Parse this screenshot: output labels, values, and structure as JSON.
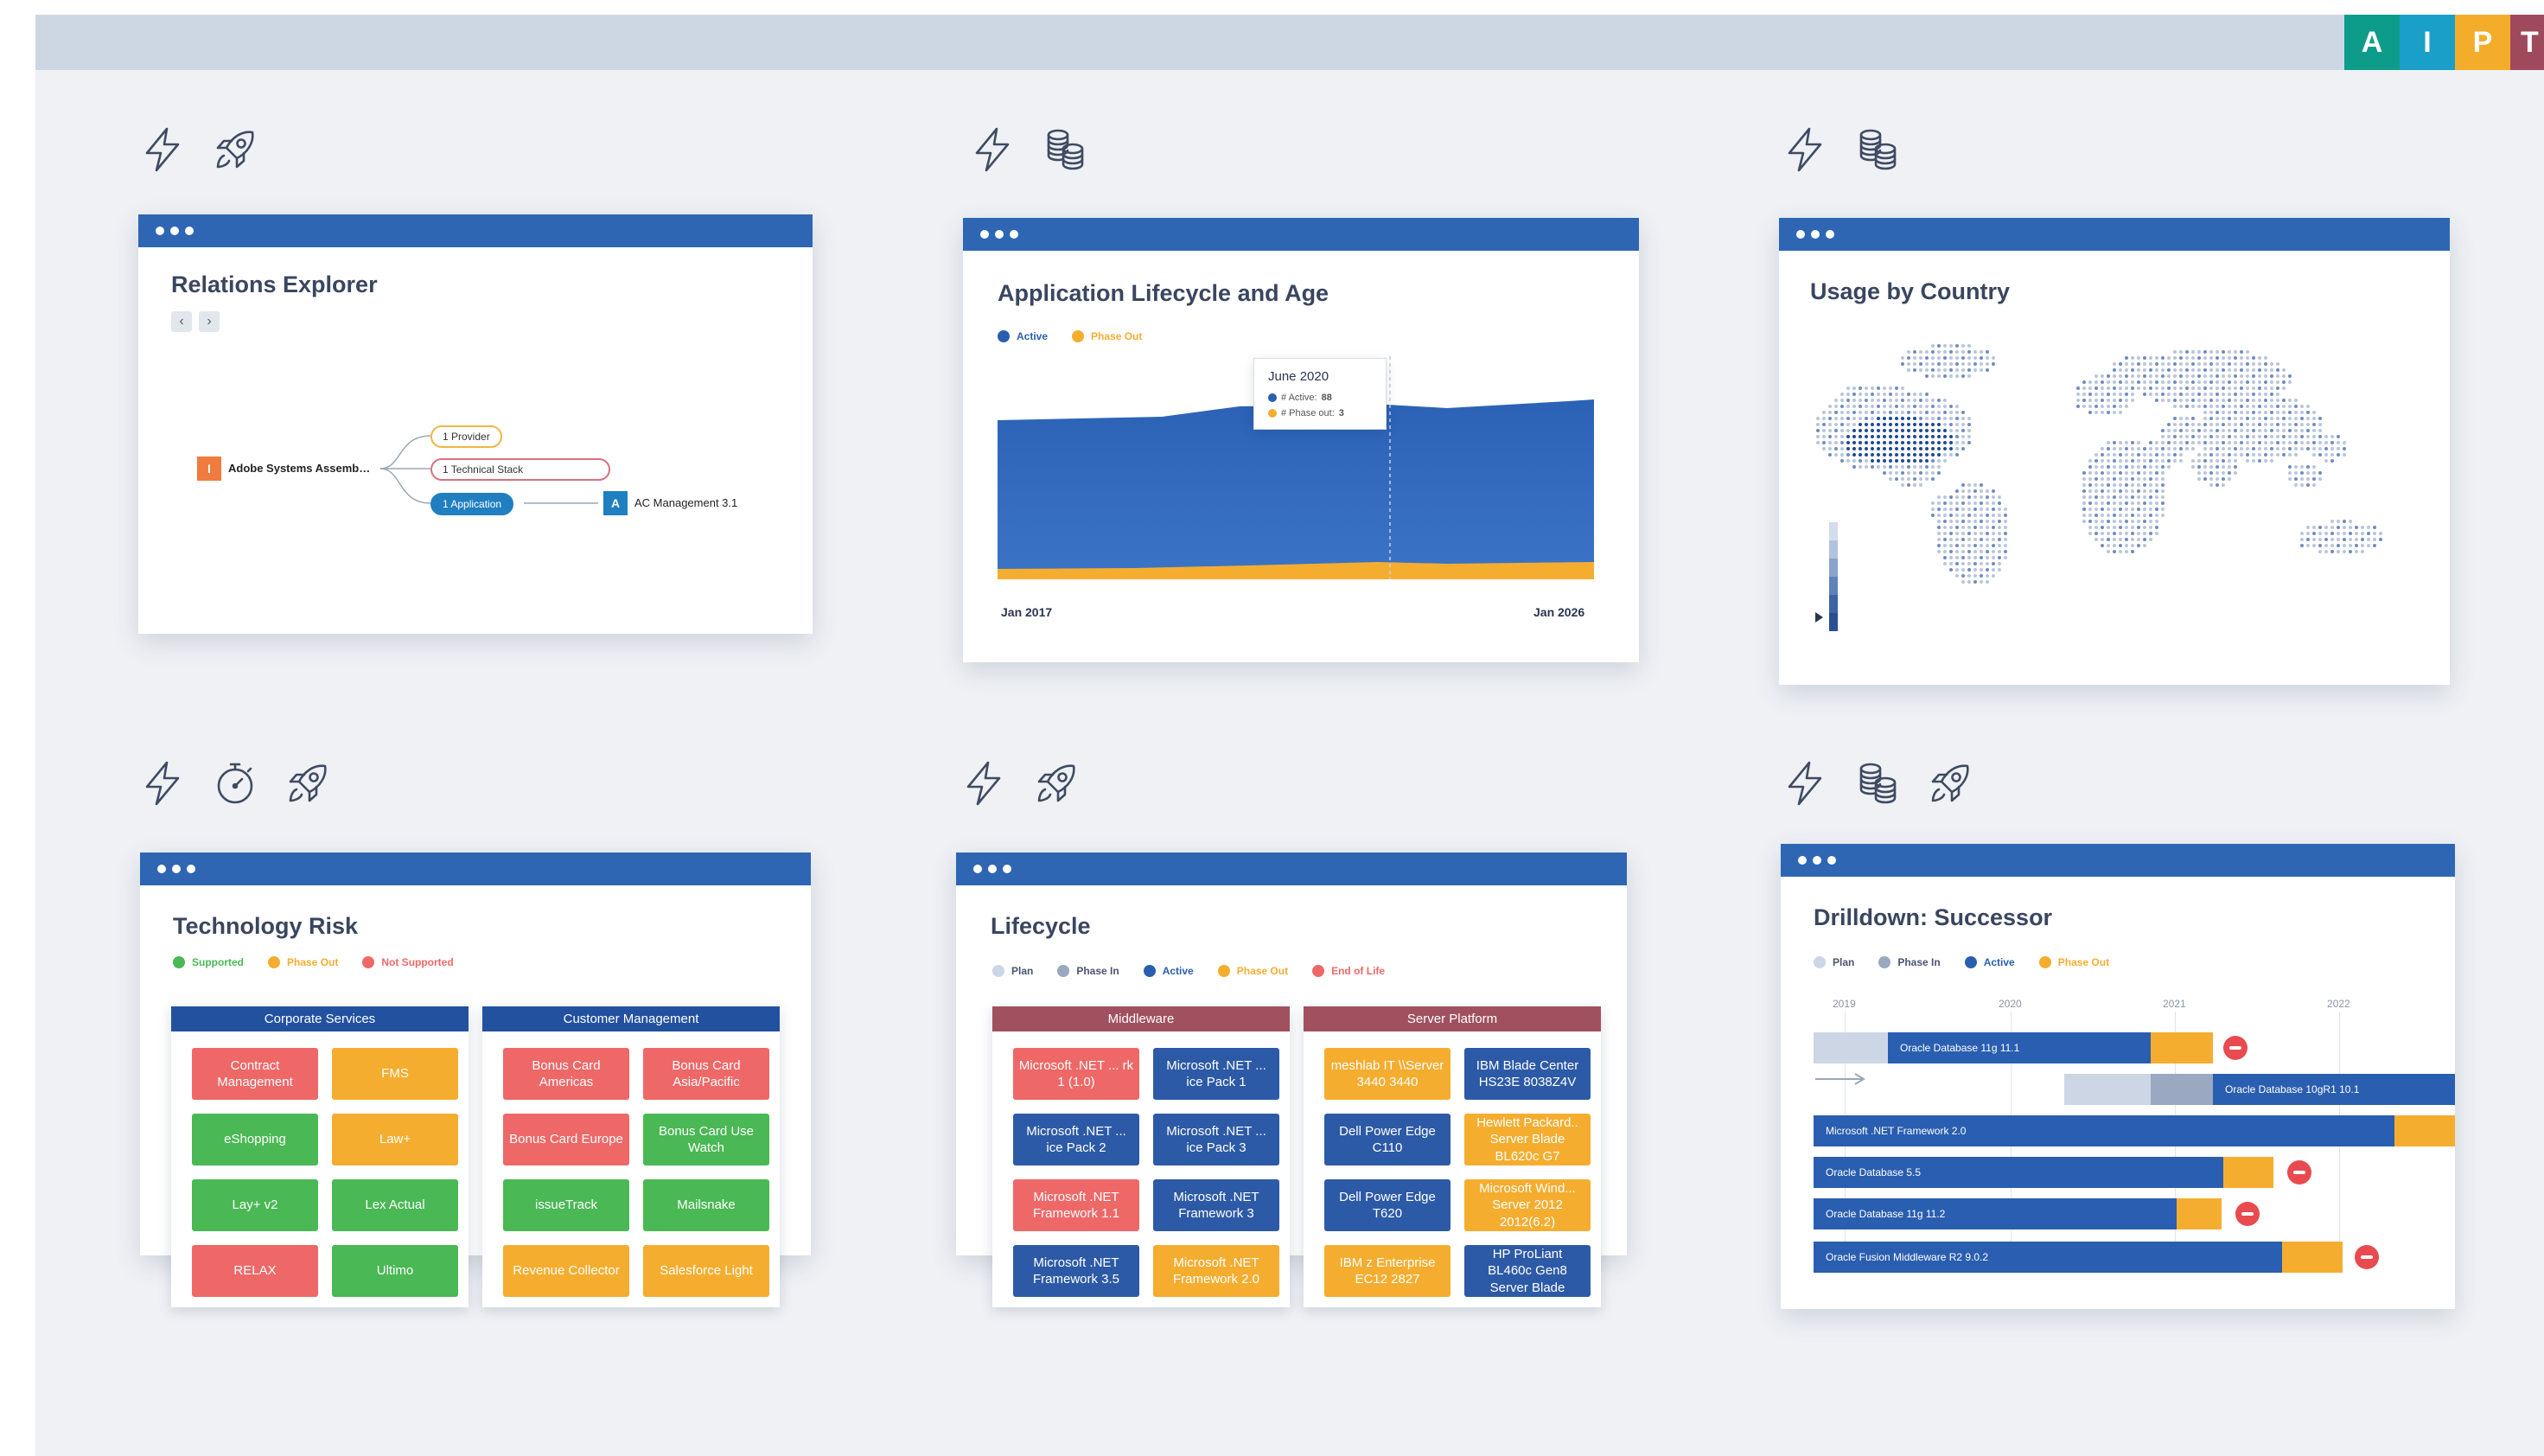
{
  "brand_letters": [
    {
      "letter": "A",
      "color": "#0e9c8a"
    },
    {
      "letter": "I",
      "color": "#1aa0c8"
    },
    {
      "letter": "P",
      "color": "#f4ad2a"
    },
    {
      "letter": "T",
      "color": "#9e4a5c"
    }
  ],
  "colors": {
    "header": "#2e66b4",
    "red": "#ee6868",
    "green": "#4ab854",
    "yellow": "#f5ad30",
    "navy": "#2d5aa6",
    "plan": "#ccd6e4",
    "phasein": "#9aa9c1",
    "active": "#2a5eb0"
  },
  "relations": {
    "title": "Relations Explorer",
    "prev": "‹",
    "next": "›",
    "root_badge": "I",
    "root_label": "Adobe Systems Assemb…",
    "pill_provider": "1 Provider",
    "pill_stack": "1 Technical Stack",
    "pill_app": "1 Application",
    "leaf_badge": "A",
    "leaf_label": "AC Management 3.1"
  },
  "lifecycle_age": {
    "title": "Application Lifecycle and Age",
    "legend_active": "Active",
    "legend_phaseout": "Phase Out",
    "tooltip_title": "June 2020",
    "tooltip_active_label": "# Active:",
    "tooltip_active_value": "88",
    "tooltip_phaseout_label": "# Phase out:",
    "tooltip_phaseout_value": "3",
    "x_start": "Jan 2017",
    "x_end": "Jan 2026"
  },
  "usage": {
    "title": "Usage by Country"
  },
  "tech_risk": {
    "title": "Technology Risk",
    "legend": [
      "Supported",
      "Phase Out",
      "Not Supported"
    ],
    "panel1_title": "Corporate Services",
    "panel1_tiles": [
      {
        "label": "Contract Management",
        "status": "red"
      },
      {
        "label": "FMS",
        "status": "yellow"
      },
      {
        "label": "eShopping",
        "status": "green"
      },
      {
        "label": "Law+",
        "status": "yellow"
      },
      {
        "label": "Lay+ v2",
        "status": "green"
      },
      {
        "label": "Lex Actual",
        "status": "green"
      },
      {
        "label": "RELAX",
        "status": "red"
      },
      {
        "label": "Ultimo",
        "status": "green"
      }
    ],
    "panel2_title": "Customer Management",
    "panel2_tiles": [
      {
        "label": "Bonus Card Americas",
        "status": "red"
      },
      {
        "label": "Bonus Card Asia/Pacific",
        "status": "red"
      },
      {
        "label": "Bonus Card Europe",
        "status": "red"
      },
      {
        "label": "Bonus Card Use Watch",
        "status": "green"
      },
      {
        "label": "issueTrack",
        "status": "green"
      },
      {
        "label": "Mailsnake",
        "status": "green"
      },
      {
        "label": "Revenue Collector",
        "status": "yellow"
      },
      {
        "label": "Salesforce Light",
        "status": "yellow"
      }
    ]
  },
  "lifecycle": {
    "title": "Lifecycle",
    "legend": [
      "Plan",
      "Phase In",
      "Active",
      "Phase Out",
      "End of Life"
    ],
    "panel1_title": "Middleware",
    "panel1_tiles": [
      {
        "label": "Microsoft .NET ... rk 1 (1.0)",
        "status": "red"
      },
      {
        "label": "Microsoft .NET ... ice Pack 1",
        "status": "navy"
      },
      {
        "label": "Microsoft .NET ... ice Pack 2",
        "status": "navy"
      },
      {
        "label": "Microsoft .NET ... ice Pack 3",
        "status": "navy"
      },
      {
        "label": "Microsoft .NET Framework 1.1",
        "status": "red"
      },
      {
        "label": "Microsoft .NET Framework 3",
        "status": "navy"
      },
      {
        "label": "Microsoft .NET Framework 3.5",
        "status": "navy"
      },
      {
        "label": "Microsoft .NET Framework 2.0",
        "status": "yellow"
      }
    ],
    "panel2_title": "Server Platform",
    "panel2_tiles": [
      {
        "label": "meshlab IT \\\\Server 3440 3440",
        "status": "yellow"
      },
      {
        "label": "IBM Blade Center HS23E 8038Z4V",
        "status": "navy"
      },
      {
        "label": "Dell Power Edge C110",
        "status": "navy"
      },
      {
        "label": "Hewlett Packard.. Server Blade BL620c G7",
        "status": "yellow"
      },
      {
        "label": "Dell Power Edge T620",
        "status": "navy"
      },
      {
        "label": "Microsoft Wind... Server 2012 2012(6.2)",
        "status": "yellow"
      },
      {
        "label": "IBM z Enterprise EC12 2827",
        "status": "yellow"
      },
      {
        "label": "HP ProLiant BL460c Gen8 Server Blade",
        "status": "navy"
      }
    ]
  },
  "drilldown": {
    "title": "Drilldown: Successor",
    "legend": [
      "Plan",
      "Phase In",
      "Active",
      "Phase Out"
    ],
    "years": [
      "2019",
      "2020",
      "2021",
      "2022"
    ],
    "bars": [
      {
        "label": "Oracle Database 11g 11.1"
      },
      {
        "label": "Oracle Database 10gR1 10.1"
      },
      {
        "label": "Microsoft .NET Framework 2.0"
      },
      {
        "label": "Oracle Database 5.5"
      },
      {
        "label": "Oracle Database 11g 11.2"
      },
      {
        "label": "Oracle Fusion Middleware R2 9.0.2"
      }
    ]
  }
}
